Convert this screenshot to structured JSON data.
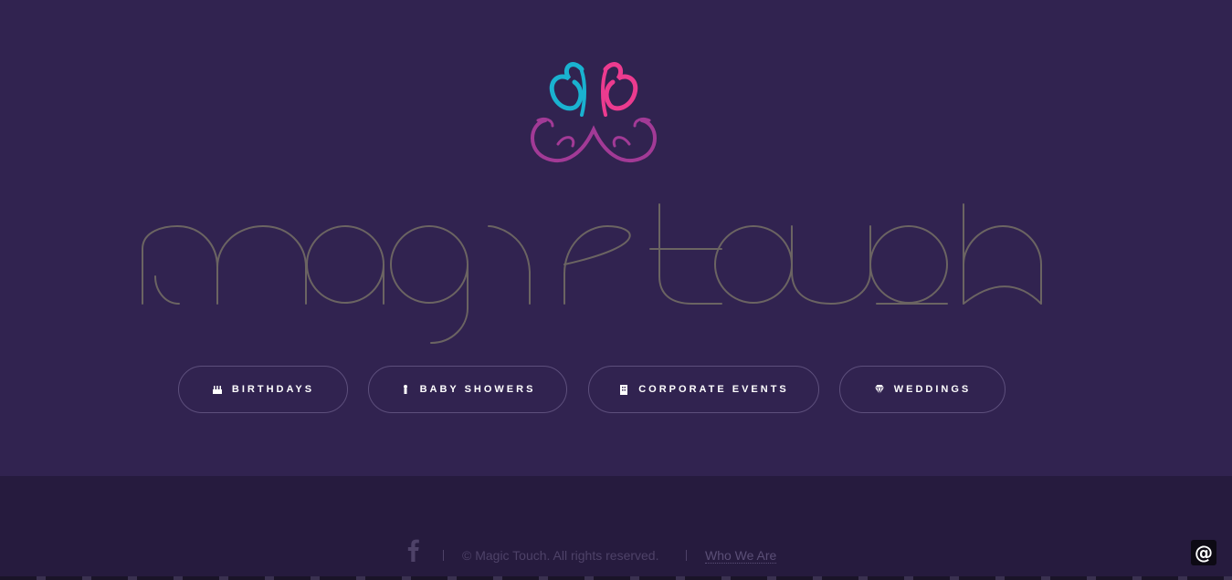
{
  "brand": {
    "logo_icon": "butterfly-icon",
    "wordmark": "magic touch",
    "colors": {
      "teal": "#1ab2d0",
      "pink": "#ec3b8f",
      "magenta": "#a23a96",
      "wordmark": "#6b6462"
    }
  },
  "nav": [
    {
      "label": "BIRTHDAYS",
      "icon": "birthday-cake-icon"
    },
    {
      "label": "BABY SHOWERS",
      "icon": "baby-icon"
    },
    {
      "label": "CORPORATE EVENTS",
      "icon": "building-icon"
    },
    {
      "label": "WEDDINGS",
      "icon": "diamond-icon"
    }
  ],
  "footer": {
    "social_icon": "facebook-icon",
    "copyright": "© Magic Touch. All rights reserved.",
    "link": "Who We Are"
  },
  "contact_button": {
    "label": "@",
    "icon": "at-icon"
  },
  "colors": {
    "background": "#312350",
    "footer": "#261b3e"
  }
}
